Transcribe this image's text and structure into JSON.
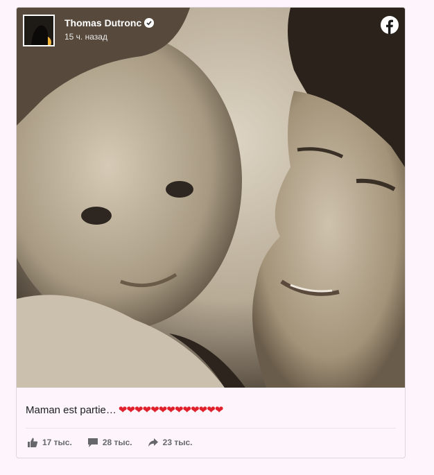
{
  "post": {
    "author": "Thomas Dutronc",
    "time": "15 ч. назад",
    "caption_text": "Maman est partie…",
    "caption_emoji_count": 13,
    "caption_emoji": "heart"
  },
  "stats": {
    "likes": "17 тыс.",
    "comments": "28 тыс.",
    "shares": "23 тыс."
  },
  "icons": {
    "verified": "verified-check-icon",
    "brand": "facebook-logo-icon",
    "like": "thumbs-up-icon",
    "comment": "comment-bubble-icon",
    "share": "share-arrow-icon"
  },
  "colors": {
    "page_background": "#fdf5fb",
    "heart": "#e0202c",
    "stat_text": "#65676b"
  }
}
